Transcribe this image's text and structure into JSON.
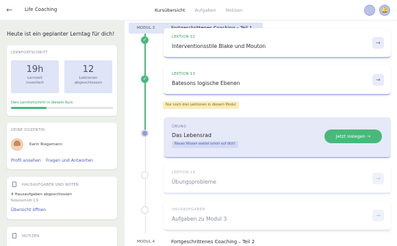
{
  "header": {
    "back_icon": "arrow-left-icon",
    "title": "Life Coaching",
    "tabs": [
      "Kursübersicht",
      "Aufgaben",
      "Notizen"
    ],
    "bell_icon": "bell-icon"
  },
  "sidebar": {
    "greeting": "Heute ist ein geplanter Lerntag für dich!",
    "progress": {
      "title": "LERNFORTSCHRITT",
      "time_value": "19h",
      "time_label": "Lernzeit investiert",
      "lessons_value": "12",
      "lessons_label": "Lektionen abgeschlossen",
      "course_label": "Dein Lernfortschritt in diesem Kurs",
      "course_progress": 0.35
    },
    "teacher": {
      "title": "DEINE DOZENTIN",
      "name": "Karin Riegemann",
      "profile_link": "Profil ansehen",
      "qa_link": "Fragen und Antworten"
    },
    "homework": {
      "title": "HAUSAUFGABEN UND NOTEN",
      "completed": "4 Hausaufgaben abgeschlossen",
      "grade": "Notenschnitt 1,9",
      "link": "Übersicht öffnen"
    },
    "notes": {
      "title": "NOTIZEN"
    }
  },
  "main": {
    "module_current": {
      "label": "MODUL 3",
      "title": "Fortgeschrittenes Coaching – Teil 1"
    },
    "lessons": [
      {
        "kicker": "LEKTION 12",
        "title": "Interventionsstile Blake und Mouton"
      },
      {
        "kicker": "LEKTION 13",
        "title": "Batesons logische Ebenen"
      }
    ],
    "notice": "Nur noch drei Lektionen in diesem Modul",
    "exercise": {
      "kicker": "ÜBUNG",
      "title": "Das Lebensrad",
      "tag": "Neues Wissen wartet schon auf dich!",
      "button": "Jetzt loslegen"
    },
    "upcoming": [
      {
        "kicker": "LEKTION 14",
        "title": "Übungsprobleme"
      },
      {
        "kicker": "HAUSAUFGABEN",
        "title": "Aufgaben zu Modul 3"
      }
    ],
    "module_next": {
      "label": "MODUL 4",
      "title": "Fortgeschrittenes Coaching – Teil 2"
    }
  },
  "colors": {
    "accent_green": "#47b97a",
    "accent_blue": "#4a5bb8",
    "panel_bg": "#edf0ea",
    "highlight": "#dfe4f6"
  }
}
